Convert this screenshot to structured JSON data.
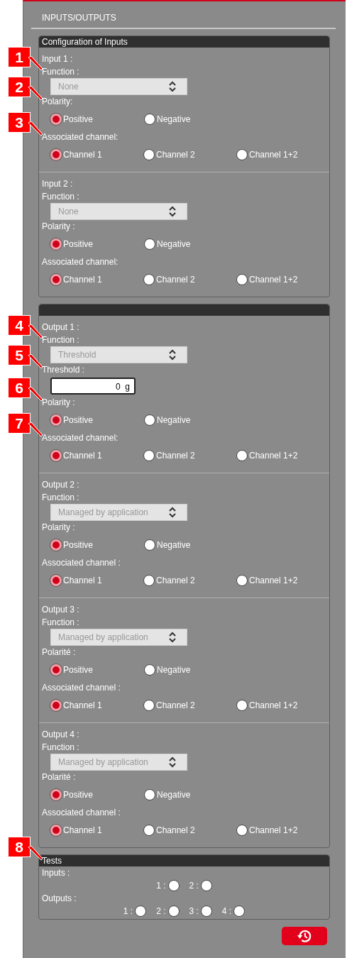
{
  "header": {
    "title": "INPUTS/OUTPUTS"
  },
  "sections": [
    {
      "title": "Configuration of Inputs",
      "groups": [
        {
          "title": "Input 1 :",
          "fields": [
            {
              "kind": "select",
              "label": "Function :",
              "callout": "1",
              "value": "None",
              "disabled": true
            },
            {
              "kind": "radios",
              "label": "Polarity:",
              "callout": "2",
              "options": [
                {
                  "label": "Positive",
                  "selected": true
                },
                {
                  "label": "Negative",
                  "selected": false
                }
              ]
            },
            {
              "kind": "radios",
              "label": "Associated channel:",
              "callout": "3",
              "options": [
                {
                  "label": "Channel 1",
                  "selected": true
                },
                {
                  "label": "Channel 2",
                  "selected": false
                },
                {
                  "label": "Channel 1+2",
                  "selected": false
                }
              ]
            }
          ]
        },
        {
          "title": "Input 2 :",
          "fields": [
            {
              "kind": "select",
              "label": "Function :",
              "value": "None",
              "disabled": true
            },
            {
              "kind": "radios",
              "label": "Polarity :",
              "options": [
                {
                  "label": "Positive",
                  "selected": true
                },
                {
                  "label": "Negative",
                  "selected": false
                }
              ]
            },
            {
              "kind": "radios",
              "label": "Associated channel:",
              "options": [
                {
                  "label": "Channel 1",
                  "selected": true
                },
                {
                  "label": "Channel 2",
                  "selected": false
                },
                {
                  "label": "Channel 1+2",
                  "selected": false
                }
              ]
            }
          ]
        }
      ]
    },
    {
      "groups": [
        {
          "title": "Output 1 :",
          "fields": [
            {
              "kind": "select",
              "label": "Function :",
              "callout": "4",
              "value": "Threshold",
              "disabled": true
            },
            {
              "kind": "number",
              "label": "Threshold :",
              "callout": "5",
              "value": "0  g"
            },
            {
              "kind": "radios",
              "label": "Polarity :",
              "callout": "6",
              "options": [
                {
                  "label": "Positive",
                  "selected": true
                },
                {
                  "label": "Negative",
                  "selected": false
                }
              ]
            },
            {
              "kind": "radios",
              "label": "Associated channel:",
              "callout": "7",
              "options": [
                {
                  "label": "Channel 1",
                  "selected": true
                },
                {
                  "label": "Channel 2",
                  "selected": false
                },
                {
                  "label": "Channel 1+2",
                  "selected": false
                }
              ]
            }
          ]
        },
        {
          "title": "Output 2 :",
          "fields": [
            {
              "kind": "select",
              "label": "Function :",
              "value": "Managed by application",
              "disabled": true
            },
            {
              "kind": "radios",
              "label": "Polarity :",
              "options": [
                {
                  "label": "Positive",
                  "selected": true
                },
                {
                  "label": "Negative",
                  "selected": false
                }
              ]
            },
            {
              "kind": "radios",
              "label": "Associated channel :",
              "options": [
                {
                  "label": "Channel 1",
                  "selected": true
                },
                {
                  "label": "Channel 2",
                  "selected": false
                },
                {
                  "label": "Channel 1+2",
                  "selected": false
                }
              ]
            }
          ]
        },
        {
          "title": "Output 3 :",
          "fields": [
            {
              "kind": "select",
              "label": "Function :",
              "value": "Managed by application",
              "disabled": true
            },
            {
              "kind": "radios",
              "label": "Polarité :",
              "options": [
                {
                  "label": "Positive",
                  "selected": true
                },
                {
                  "label": "Negative",
                  "selected": false
                }
              ]
            },
            {
              "kind": "radios",
              "label": "Associated channel  :",
              "options": [
                {
                  "label": "Channel 1",
                  "selected": true
                },
                {
                  "label": "Channel 2",
                  "selected": false
                },
                {
                  "label": "Channel 1+2",
                  "selected": false
                }
              ]
            }
          ]
        },
        {
          "title": "Output 4 :",
          "fields": [
            {
              "kind": "select",
              "label": "Function :",
              "value": "Managed by application",
              "disabled": true
            },
            {
              "kind": "radios",
              "label": "Polarité :",
              "options": [
                {
                  "label": "Positive",
                  "selected": true
                },
                {
                  "label": "Negative",
                  "selected": false
                }
              ]
            },
            {
              "kind": "radios",
              "label": "Associated channel :",
              "options": [
                {
                  "label": "Channel 1",
                  "selected": true
                },
                {
                  "label": "Channel 2",
                  "selected": false
                },
                {
                  "label": "Channel 1+2",
                  "selected": false
                }
              ]
            }
          ]
        }
      ]
    }
  ],
  "tests": {
    "title": "Tests",
    "callout": "8",
    "rows": [
      {
        "label": "Inputs :",
        "leds": [
          {
            "label": "1 :",
            "on": false
          },
          {
            "label": "2 :",
            "on": false
          }
        ]
      },
      {
        "label": "Outputs :",
        "leds": [
          {
            "label": "1 :",
            "on": false
          },
          {
            "label": "2 :",
            "on": false
          },
          {
            "label": "3 :",
            "on": false
          },
          {
            "label": "4 :",
            "on": false
          }
        ]
      }
    ]
  }
}
